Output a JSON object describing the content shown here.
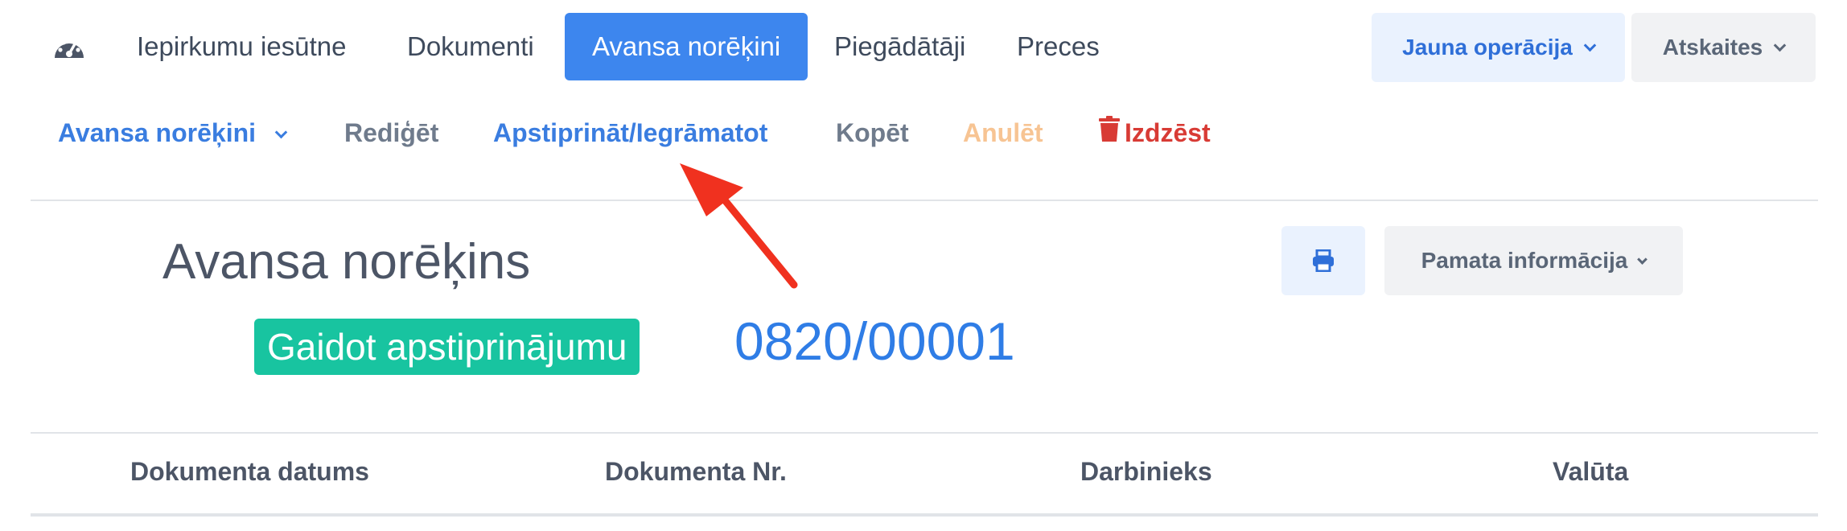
{
  "topnav": {
    "dashboard_icon": "speedometer-icon",
    "items": [
      {
        "label": "Iepirkumu iesūtne"
      },
      {
        "label": "Dokumenti"
      },
      {
        "label": "Avansa norēķini",
        "active": true
      },
      {
        "label": "Piegādātāji"
      },
      {
        "label": "Preces"
      }
    ],
    "new_operation_label": "Jauna operācija",
    "reports_label": "Atskaites"
  },
  "actions": {
    "type_label": "Avansa norēķini",
    "edit_label": "Rediģēt",
    "approve_label": "Apstiprināt/Iegrāmatot",
    "copy_label": "Kopēt",
    "cancel_label": "Anulēt",
    "delete_label": "Izdzēst",
    "delete_icon": "trash-icon"
  },
  "document": {
    "title": "Avansa norēķins",
    "status": "Gaidot apstiprinājumu",
    "number": "0820/00001",
    "print_icon": "printer-icon",
    "basic_info_label": "Pamata informācija"
  },
  "table": {
    "columns": [
      "Dokumenta datums",
      "Dokumenta Nr.",
      "Darbinieks",
      "Valūta"
    ]
  },
  "colors": {
    "accent": "#3d86ee",
    "status": "#18c4a0",
    "delete": "#d83b35",
    "annotation_arrow": "#f0311f"
  }
}
